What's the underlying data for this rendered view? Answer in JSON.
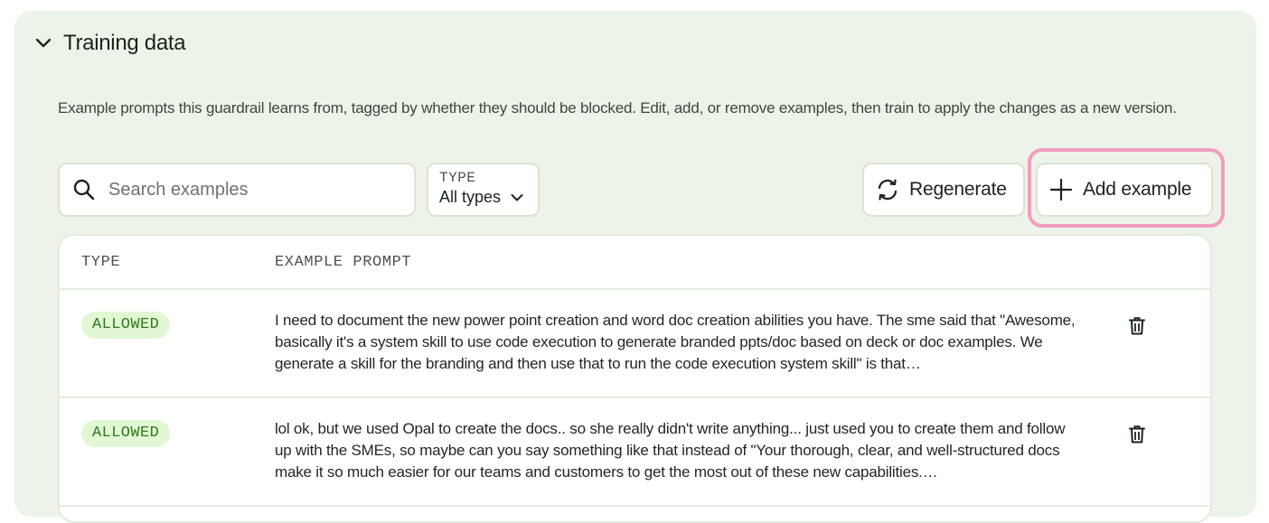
{
  "section": {
    "title": "Training data",
    "description": "Example prompts this guardrail learns from, tagged by whether they should be blocked. Edit, add, or remove examples, then train to apply the changes as a new version."
  },
  "toolbar": {
    "search_placeholder": "Search examples",
    "type_filter_caption": "TYPE",
    "type_filter_value": "All types",
    "regenerate_label": "Regenerate",
    "add_example_label": "Add example"
  },
  "table": {
    "columns": [
      "TYPE",
      "EXAMPLE PROMPT"
    ],
    "rows": [
      {
        "type": "ALLOWED",
        "prompt": "I need to document the new power point creation and word doc creation abilities you have. The sme said that \"Awesome, basically it's a system skill to use code execution to generate branded ppts/doc based on deck or doc examples. We generate a skill for the branding and then use that to run the code execution system skill\" is that…"
      },
      {
        "type": "ALLOWED",
        "prompt": "lol ok, but we used Opal to create the docs.. so she really didn't write anything... just used you to create them and follow up with the SMEs, so maybe can you say something like that instead of \"Your thorough, clear, and well-structured docs make it so much easier for our teams and customers to get the most out of these new capabilities.…"
      }
    ]
  },
  "colors": {
    "panel_bg": "#eef3ea",
    "badge_allowed_bg": "#e2f7d3",
    "badge_allowed_text": "#2f7a1d",
    "highlight": "#f19ec0"
  },
  "icons": {
    "collapse": "chevron-down-icon",
    "search": "search-icon",
    "filter": "chevron-down-icon",
    "regenerate": "refresh-icon",
    "add": "plus-icon",
    "delete": "trash-icon"
  }
}
